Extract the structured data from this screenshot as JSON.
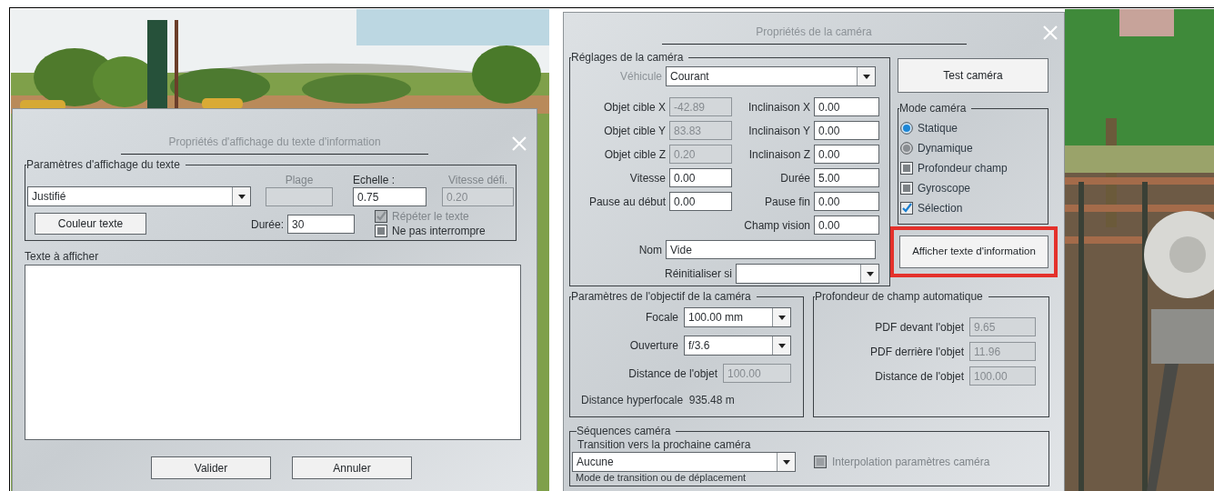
{
  "left_dialog": {
    "title": "Propriétés d'affichage du texte d'information",
    "group": {
      "title": "Paramètres d'affichage du texte",
      "alignment": {
        "value": "Justifié"
      },
      "fields": [
        {
          "label": "Plage",
          "disabled": true
        },
        {
          "label": "Echelle :",
          "value": "0.75",
          "disabled": false
        },
        {
          "label": "Vitesse défi.",
          "value": "0.20",
          "disabled": true
        }
      ],
      "color_button": "Couleur texte",
      "duration": {
        "label": "Durée:",
        "value": "30"
      },
      "checkboxes": [
        {
          "label": "Répéter le texte",
          "checked": true,
          "disabled": true
        },
        {
          "label": "Ne pas interrompre",
          "checked": false,
          "disabled": false
        }
      ]
    },
    "text_label": "Texte à afficher",
    "buttons": [
      "Valider",
      "Annuler"
    ]
  },
  "camera_dialog": {
    "title": "Propriétés de la caméra",
    "settings": {
      "title": "Réglages de la caméra",
      "vehicle": {
        "label": "Véhicule",
        "value": "Courant",
        "disabled": true
      },
      "left_fields": [
        {
          "label": "Objet cible X",
          "value": "-42.89",
          "disabled": true
        },
        {
          "label": "Objet cible Y",
          "value": "83.83",
          "disabled": true
        },
        {
          "label": "Objet cible Z",
          "value": "0.20",
          "disabled": true
        },
        {
          "label": "Vitesse",
          "value": "0.00",
          "disabled": false
        },
        {
          "label": "Pause au début",
          "value": "0.00",
          "disabled": false
        }
      ],
      "right_fields": [
        {
          "label": "Inclinaison X",
          "value": "0.00"
        },
        {
          "label": "Inclinaison Y",
          "value": "0.00"
        },
        {
          "label": "Inclinaison Z",
          "value": "0.00"
        },
        {
          "label": "Durée",
          "value": "5.00"
        },
        {
          "label": "Pause fin",
          "value": "0.00"
        },
        {
          "label": "Champ vision",
          "value": "0.00"
        }
      ],
      "name": {
        "label": "Nom",
        "value": "Vide"
      },
      "reset": {
        "label": "Réinitialiser si"
      }
    },
    "test_button": "Test caméra",
    "mode": {
      "title": "Mode caméra",
      "options": [
        {
          "kind": "radio",
          "label": "Statique",
          "selected": true
        },
        {
          "kind": "radio",
          "label": "Dynamique",
          "selected": false
        },
        {
          "kind": "checkbox",
          "label": "Profondeur champ",
          "checked": false
        },
        {
          "kind": "checkbox",
          "label": "Gyroscope",
          "checked": false
        },
        {
          "kind": "checkbox",
          "label": "Sélection",
          "checked": true
        }
      ]
    },
    "info_button": {
      "label": "Afficher texte d'information",
      "highlighted": true
    },
    "lens": {
      "title": "Paramètres de l'objectif de la caméra",
      "focal": {
        "label": "Focale",
        "value": "100.00 mm"
      },
      "aperture": {
        "label": "Ouverture",
        "value": "f/3.6"
      },
      "distance": {
        "label": "Distance de l'objet",
        "value": "100.00",
        "disabled": true
      },
      "hyperfocal": "Distance hyperfocale  935.48 m"
    },
    "auto_dof": {
      "title": "Profondeur de champ automatique",
      "fields": [
        {
          "label": "PDF devant l'objet",
          "value": "9.65"
        },
        {
          "label": "PDF derrière l'objet",
          "value": "11.96"
        },
        {
          "label": "Distance de l'objet",
          "value": "100.00"
        }
      ]
    },
    "sequences": {
      "title": "Séquences caméra",
      "transition_label": "Transition vers la prochaine caméra",
      "transition": {
        "value": "Aucune"
      },
      "interpolation": {
        "label": "Interpolation paramètres caméra",
        "checked": false,
        "disabled": true
      },
      "mode_label": "Mode de transition ou de déplacement"
    }
  }
}
